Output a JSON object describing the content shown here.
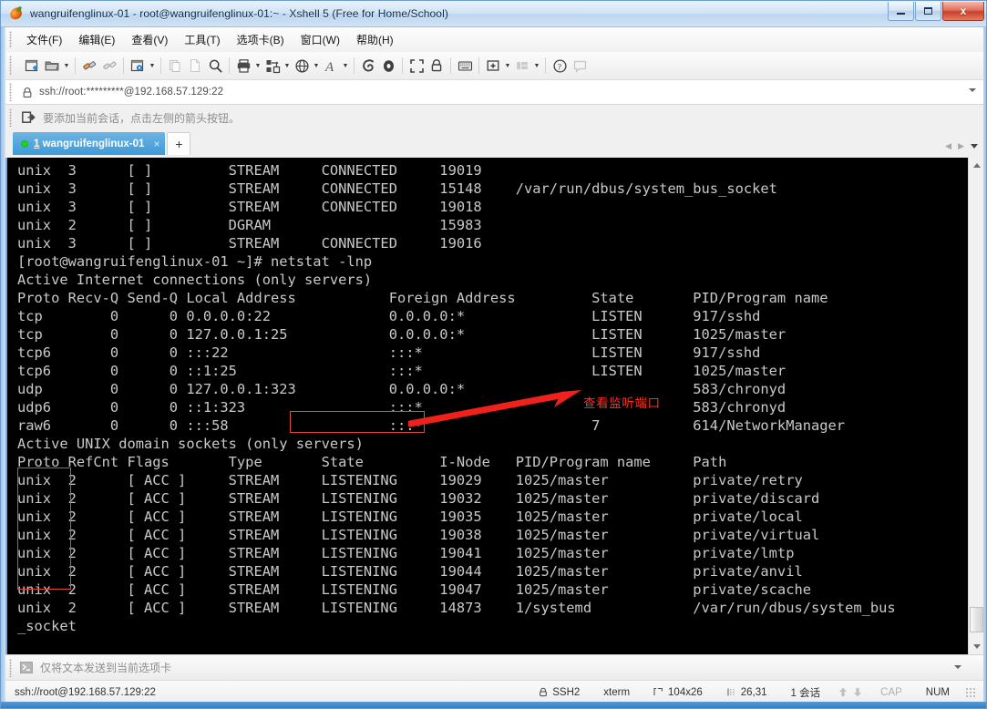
{
  "window": {
    "title": "wangruifenglinux-01 - root@wangruifenglinux-01:~ - Xshell 5 (Free for Home/School)",
    "minimize_label": "Minimize",
    "maximize_label": "Maximize",
    "close_label": "x"
  },
  "menu": {
    "items": [
      {
        "label": "文件(F)",
        "name": "menu-file"
      },
      {
        "label": "编辑(E)",
        "name": "menu-edit"
      },
      {
        "label": "查看(V)",
        "name": "menu-view"
      },
      {
        "label": "工具(T)",
        "name": "menu-tools"
      },
      {
        "label": "选项卡(B)",
        "name": "menu-tabs"
      },
      {
        "label": "窗口(W)",
        "name": "menu-window"
      },
      {
        "label": "帮助(H)",
        "name": "menu-help"
      }
    ]
  },
  "toolbar": {
    "icons": [
      "new-session-icon",
      "open-folder-icon",
      "separator",
      "connect-icon",
      "disconnect-icon",
      "separator",
      "session-properties-icon",
      "separator",
      "cut-icon",
      "copy-icon",
      "find-icon",
      "separator",
      "print-icon",
      "transfer-icon",
      "globe-icon",
      "font-icon",
      "separator",
      "log-icon",
      "record-icon",
      "separator",
      "fullscreen-icon",
      "lock-icon",
      "separator",
      "keyboard-icon",
      "separator",
      "add-tab-icon",
      "layout-icon",
      "separator",
      "help-icon",
      "feedback-icon"
    ]
  },
  "address": {
    "value": "ssh://root:*********@192.168.57.129:22",
    "lock_icon": "lock-icon",
    "dropdown_icon": "chevron-down-icon"
  },
  "hint": {
    "icon": "add-session-icon",
    "text": "要添加当前会话，点击左侧的箭头按钮。"
  },
  "tabs": {
    "items": [
      {
        "number": "1",
        "title": "wangruifenglinux-01",
        "close_label": "×",
        "status": "connected"
      }
    ],
    "new_tab_label": "+",
    "nav_prev": "◀",
    "nav_next": "▶"
  },
  "terminal": {
    "lines": [
      "unix  3      [ ]         STREAM     CONNECTED     19019",
      "unix  3      [ ]         STREAM     CONNECTED     15148    /var/run/dbus/system_bus_socket",
      "unix  3      [ ]         STREAM     CONNECTED     19018",
      "unix  2      [ ]         DGRAM                    15983",
      "unix  3      [ ]         STREAM     CONNECTED     19016",
      "[root@wangruifenglinux-01 ~]# netstat -lnp",
      "Active Internet connections (only servers)",
      "Proto Recv-Q Send-Q Local Address           Foreign Address         State       PID/Program name",
      "tcp        0      0 0.0.0.0:22              0.0.0.0:*               LISTEN      917/sshd",
      "tcp        0      0 127.0.0.1:25            0.0.0.0:*               LISTEN      1025/master",
      "tcp6       0      0 :::22                   :::*                    LISTEN      917/sshd",
      "tcp6       0      0 ::1:25                  :::*                    LISTEN      1025/master",
      "udp        0      0 127.0.0.1:323           0.0.0.0:*                           583/chronyd",
      "udp6       0      0 ::1:323                 :::*                                583/chronyd",
      "raw6       0      0 :::58                   :::*                    7           614/NetworkManager",
      "Active UNIX domain sockets (only servers)",
      "Proto RefCnt Flags       Type       State         I-Node   PID/Program name     Path",
      "unix  2      [ ACC ]     STREAM     LISTENING     19029    1025/master          private/retry",
      "unix  2      [ ACC ]     STREAM     LISTENING     19032    1025/master          private/discard",
      "unix  2      [ ACC ]     STREAM     LISTENING     19035    1025/master          private/local",
      "unix  2      [ ACC ]     STREAM     LISTENING     19038    1025/master          private/virtual",
      "unix  2      [ ACC ]     STREAM     LISTENING     19041    1025/master          private/lmtp",
      "unix  2      [ ACC ]     STREAM     LISTENING     19044    1025/master          private/anvil",
      "unix  2      [ ACC ]     STREAM     LISTENING     19047    1025/master          private/scache",
      "unix  2      [ ACC ]     STREAM     LISTENING     14873    1/systemd            /var/run/dbus/system_bus",
      "_socket"
    ],
    "foreground_color": "#c9c9c9",
    "background_color": "#000000"
  },
  "annotations": {
    "label_text": "查看监听端口",
    "color": "#ff2f21",
    "boxes": [
      "command-highlight",
      "proto-column-highlight"
    ]
  },
  "send_bar": {
    "icon": "terminal-prompt-icon",
    "text": "仅将文本发送到当前选项卡",
    "dropdown_icon": "chevron-down-icon"
  },
  "status_bar": {
    "connection": "ssh://root@192.168.57.129:22",
    "protocol": "SSH2",
    "protocol_icon": "lock-icon",
    "terminal_type": "xterm",
    "size": "104x26",
    "size_icon": "resize-icon",
    "cursor": "26,31",
    "cursor_icon": "cursor-icon",
    "sessions": "1 会话",
    "up_arrow": "▲",
    "down_arrow": "▼",
    "caps": "CAP",
    "num": "NUM"
  }
}
